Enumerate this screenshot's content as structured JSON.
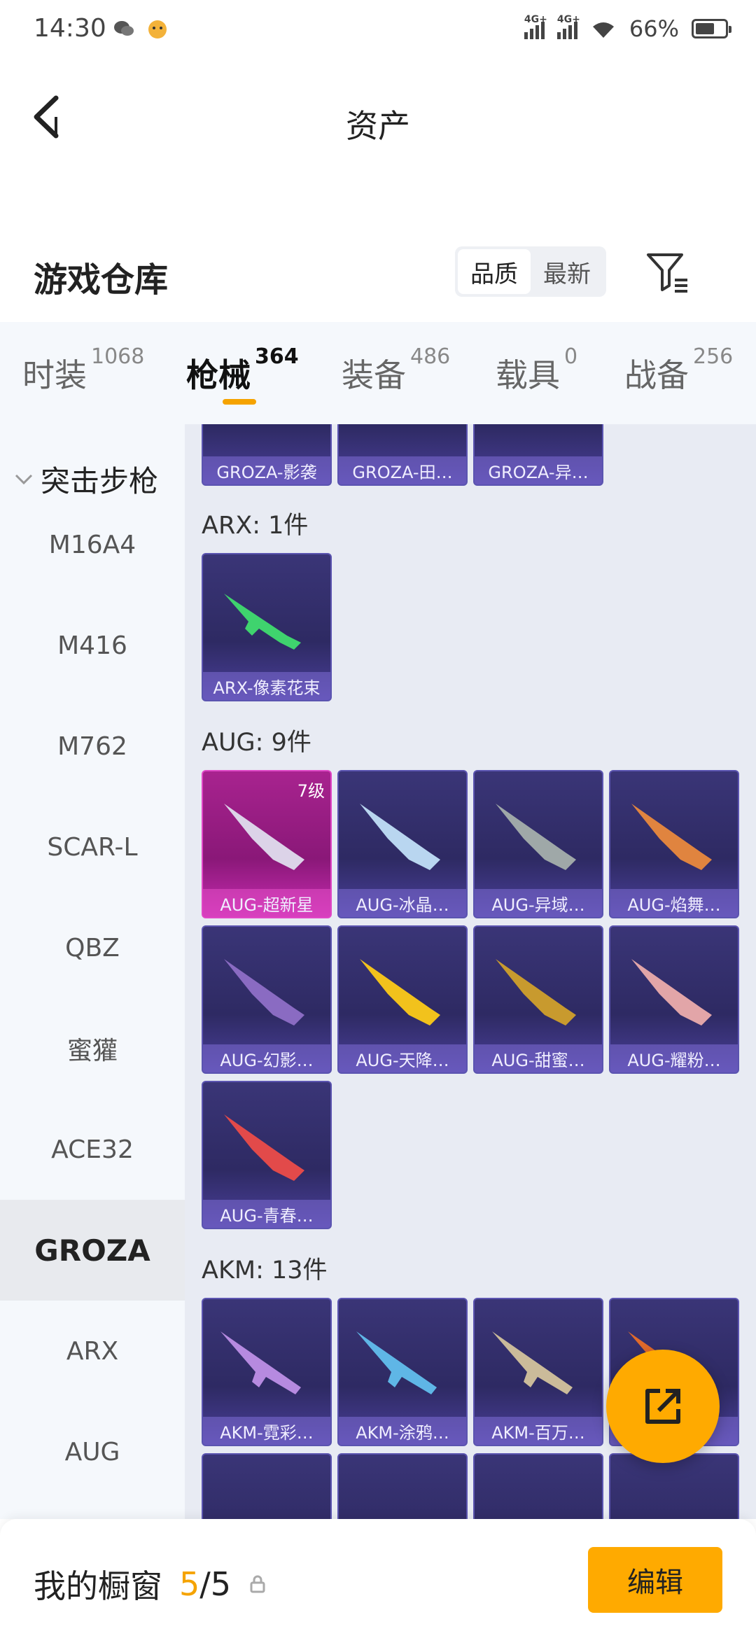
{
  "status_bar": {
    "time": "14:30",
    "signal1": "4G+",
    "signal2": "4G+",
    "battery": "66%"
  },
  "header": {
    "title": "资产"
  },
  "warehouse": {
    "title": "游戏仓库",
    "sort_options": [
      "品质",
      "最新"
    ],
    "sort_active": 0
  },
  "tabs": [
    {
      "label": "时装",
      "count": "1068"
    },
    {
      "label": "枪械",
      "count": "364"
    },
    {
      "label": "装备",
      "count": "486"
    },
    {
      "label": "载具",
      "count": "0"
    },
    {
      "label": "战备",
      "count": "256"
    }
  ],
  "active_tab": 1,
  "sidebar": {
    "category": "突击步枪",
    "items": [
      "M16A4",
      "M416",
      "M762",
      "SCAR-L",
      "QBZ",
      "蜜獾",
      "ACE32",
      "GROZA",
      "ARX",
      "AUG"
    ],
    "active_item": "GROZA"
  },
  "sections": [
    {
      "label": "",
      "items": [
        "GROZA-影袭",
        "GROZA-田…",
        "GROZA-异…"
      ]
    },
    {
      "label": "ARX: 1件",
      "items": [
        "ARX-像素花束"
      ]
    },
    {
      "label": "AUG: 9件",
      "items": [
        "AUG-超新星",
        "AUG-冰晶…",
        "AUG-异域…",
        "AUG-焰舞…",
        "AUG-幻影…",
        "AUG-天降…",
        "AUG-甜蜜…",
        "AUG-耀粉…",
        "AUG-青春…"
      ],
      "level_badge": "7级"
    },
    {
      "label": "AKM: 13件",
      "items": [
        "AKM-霓彩…",
        "AKM-涂鸦…",
        "AKM-百万…",
        ""
      ]
    }
  ],
  "bottom_bar": {
    "label": "我的橱窗",
    "current": "5",
    "total": "/5",
    "edit_label": "编辑"
  },
  "colors": {
    "accent": "#ffaa00",
    "card_bg": "#2e2a63",
    "card_highlight": "#a8238f"
  }
}
